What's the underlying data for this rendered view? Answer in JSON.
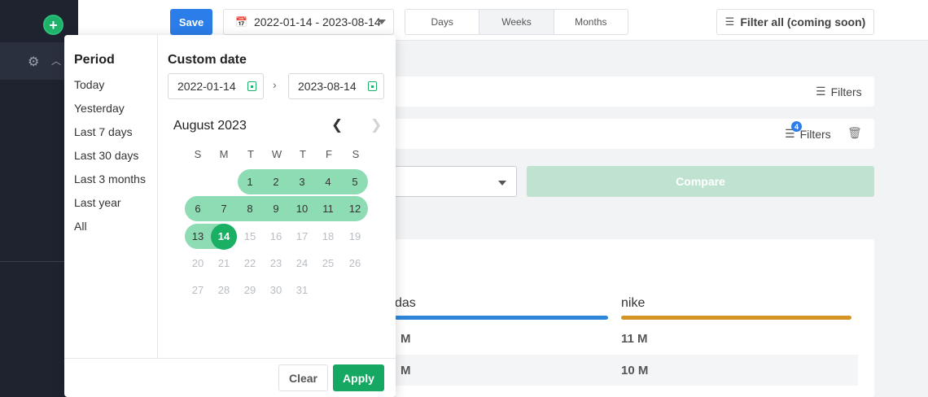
{
  "sidebar": {
    "add_icon": "plus-icon",
    "gear_icon": "gear-icon",
    "chevron_icon": "chevron-up-icon"
  },
  "toolbar": {
    "save_label": "Save",
    "date_range": "2022-01-14 - 2023-08-14",
    "granularity": [
      "Days",
      "Weeks",
      "Months"
    ],
    "granularity_selected": "Weeks",
    "filter_all_label": "Filter all (coming soon)"
  },
  "background": {
    "filters_label_1": "Filters",
    "filters_label_2": "Filters",
    "filters_count": "4",
    "compare_label": "Compare",
    "brand_1": "das",
    "brand_2": "nike",
    "brand_1_color": "#2f86d9",
    "brand_2_color": "#d49522",
    "metric_1a": "M",
    "metric_1b": "M",
    "metric_2a": "11 M",
    "metric_2b": "10 M"
  },
  "picker": {
    "period_title": "Period",
    "periods": [
      "Today",
      "Yesterday",
      "Last 7 days",
      "Last 30 days",
      "Last 3 months",
      "Last year",
      "All"
    ],
    "custom_title": "Custom date",
    "start_date": "2022-01-14",
    "end_date": "2023-08-14",
    "month_label": "August 2023",
    "weekdays": [
      "S",
      "M",
      "T",
      "W",
      "T",
      "F",
      "S"
    ],
    "weeks": [
      [
        "",
        "",
        "1",
        "2",
        "3",
        "4",
        "5"
      ],
      [
        "6",
        "7",
        "8",
        "9",
        "10",
        "11",
        "12"
      ],
      [
        "13",
        "14",
        "15",
        "16",
        "17",
        "18",
        "19"
      ],
      [
        "20",
        "21",
        "22",
        "23",
        "24",
        "25",
        "26"
      ],
      [
        "27",
        "28",
        "29",
        "30",
        "31",
        "",
        ""
      ]
    ],
    "selected_day": "14",
    "clear_label": "Clear",
    "apply_label": "Apply",
    "accent_color": "#19b064"
  }
}
